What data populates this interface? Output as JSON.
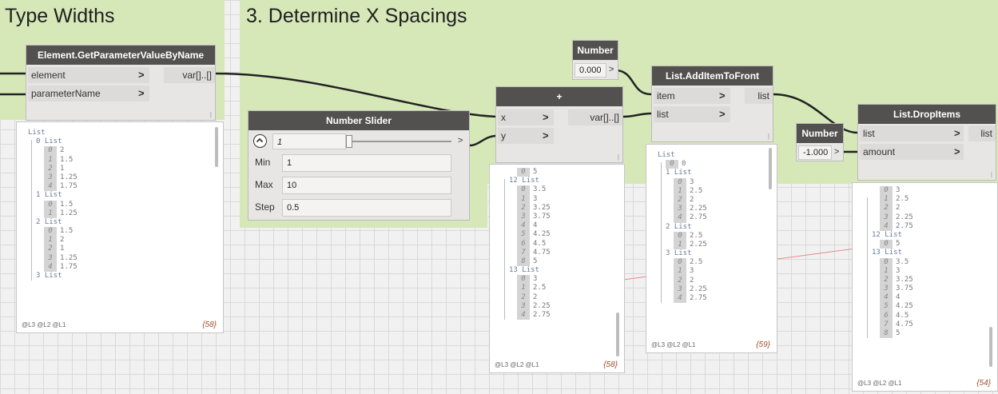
{
  "groups": {
    "type_widths": {
      "title": "Type Widths"
    },
    "x_spacings": {
      "title": "3. Determine X Spacings"
    }
  },
  "colors": {
    "group_bg": "#d6e8b8",
    "node_header": "#535150",
    "node_body": "#e7e6e5",
    "wire": "#222222"
  },
  "nodes": {
    "get_param": {
      "title": "Element.GetParameterValueByName",
      "inputs": [
        "element",
        "parameterName"
      ],
      "output": "var[]..[]"
    },
    "slider": {
      "title": "Number Slider",
      "value": "1",
      "min_label": "Min",
      "min": "1",
      "max_label": "Max",
      "max": "10",
      "step_label": "Step",
      "step": "0.5",
      "expander_icon": "chevron-up-icon"
    },
    "plus": {
      "title": "+",
      "inputs": [
        "x",
        "y"
      ],
      "output": "var[]..[]"
    },
    "number_top": {
      "title": "Number",
      "value": "0.000"
    },
    "add_front": {
      "title": "List.AddItemToFront",
      "inputs": [
        "item",
        "list"
      ],
      "output": "list"
    },
    "number_neg": {
      "title": "Number",
      "value": "-1.000"
    },
    "drop_items": {
      "title": "List.DropItems",
      "inputs": [
        "list",
        "amount"
      ],
      "output": "list"
    }
  },
  "arrow_glyph": ">",
  "grip_glyph": "|",
  "previews": {
    "p1": {
      "footer": "@L3 @L2 @L1",
      "count": "{58}",
      "rows": [
        {
          "t": "h",
          "text": "List",
          "ind": 0
        },
        {
          "t": "h",
          "text": "0 List",
          "ind": 1
        },
        {
          "t": "i",
          "i": "0",
          "v": "2",
          "ind": 2
        },
        {
          "t": "i",
          "i": "1",
          "v": "1.5",
          "ind": 2
        },
        {
          "t": "i",
          "i": "2",
          "v": "1",
          "ind": 2
        },
        {
          "t": "i",
          "i": "3",
          "v": "1.25",
          "ind": 2
        },
        {
          "t": "i",
          "i": "4",
          "v": "1.75",
          "ind": 2
        },
        {
          "t": "h",
          "text": "1 List",
          "ind": 1
        },
        {
          "t": "i",
          "i": "0",
          "v": "1.5",
          "ind": 2
        },
        {
          "t": "i",
          "i": "1",
          "v": "1.25",
          "ind": 2
        },
        {
          "t": "h",
          "text": "2 List",
          "ind": 1
        },
        {
          "t": "i",
          "i": "0",
          "v": "1.5",
          "ind": 2
        },
        {
          "t": "i",
          "i": "1",
          "v": "2",
          "ind": 2
        },
        {
          "t": "i",
          "i": "2",
          "v": "1",
          "ind": 2
        },
        {
          "t": "i",
          "i": "3",
          "v": "1.25",
          "ind": 2
        },
        {
          "t": "i",
          "i": "4",
          "v": "1.75",
          "ind": 2
        },
        {
          "t": "h",
          "text": "3 List",
          "ind": 1
        }
      ]
    },
    "p2": {
      "footer": "@L3 @L2 @L1",
      "count": "{58}",
      "rows": [
        {
          "t": "i",
          "i": "0",
          "v": "5",
          "ind": 2
        },
        {
          "t": "h",
          "text": "12 List",
          "ind": 1
        },
        {
          "t": "i",
          "i": "0",
          "v": "3.5",
          "ind": 2
        },
        {
          "t": "i",
          "i": "1",
          "v": "3",
          "ind": 2
        },
        {
          "t": "i",
          "i": "2",
          "v": "3.25",
          "ind": 2
        },
        {
          "t": "i",
          "i": "3",
          "v": "3.75",
          "ind": 2
        },
        {
          "t": "i",
          "i": "4",
          "v": "4",
          "ind": 2
        },
        {
          "t": "i",
          "i": "5",
          "v": "4.25",
          "ind": 2
        },
        {
          "t": "i",
          "i": "6",
          "v": "4.5",
          "ind": 2
        },
        {
          "t": "i",
          "i": "7",
          "v": "4.75",
          "ind": 2
        },
        {
          "t": "i",
          "i": "8",
          "v": "5",
          "ind": 2
        },
        {
          "t": "h",
          "text": "13 List",
          "ind": 1
        },
        {
          "t": "i",
          "i": "0",
          "v": "3",
          "ind": 2
        },
        {
          "t": "i",
          "i": "1",
          "v": "2.5",
          "ind": 2
        },
        {
          "t": "i",
          "i": "2",
          "v": "2",
          "ind": 2
        },
        {
          "t": "i",
          "i": "3",
          "v": "2.25",
          "ind": 2
        },
        {
          "t": "i",
          "i": "4",
          "v": "2.75",
          "ind": 2
        }
      ]
    },
    "p3": {
      "footer": "@L3 @L2 @L1",
      "count": "{59}",
      "rows": [
        {
          "t": "h",
          "text": "List",
          "ind": 0
        },
        {
          "t": "i",
          "i": "0",
          "v": "0",
          "ind": 1
        },
        {
          "t": "h",
          "text": "1 List",
          "ind": 1
        },
        {
          "t": "i",
          "i": "0",
          "v": "3",
          "ind": 2
        },
        {
          "t": "i",
          "i": "1",
          "v": "2.5",
          "ind": 2
        },
        {
          "t": "i",
          "i": "2",
          "v": "2",
          "ind": 2
        },
        {
          "t": "i",
          "i": "3",
          "v": "2.25",
          "ind": 2
        },
        {
          "t": "i",
          "i": "4",
          "v": "2.75",
          "ind": 2
        },
        {
          "t": "h",
          "text": "2 List",
          "ind": 1
        },
        {
          "t": "i",
          "i": "0",
          "v": "2.5",
          "ind": 2
        },
        {
          "t": "i",
          "i": "1",
          "v": "2.25",
          "ind": 2
        },
        {
          "t": "h",
          "text": "3 List",
          "ind": 1
        },
        {
          "t": "i",
          "i": "0",
          "v": "2.5",
          "ind": 2
        },
        {
          "t": "i",
          "i": "1",
          "v": "3",
          "ind": 2
        },
        {
          "t": "i",
          "i": "2",
          "v": "2",
          "ind": 2
        },
        {
          "t": "i",
          "i": "3",
          "v": "2.25",
          "ind": 2
        },
        {
          "t": "i",
          "i": "4",
          "v": "2.75",
          "ind": 2
        }
      ]
    },
    "p4": {
      "footer": "@L3 @L2 @L1",
      "count": "{54}",
      "rows": [
        {
          "t": "i",
          "i": "0",
          "v": "3",
          "ind": 2
        },
        {
          "t": "i",
          "i": "1",
          "v": "2.5",
          "ind": 2
        },
        {
          "t": "i",
          "i": "2",
          "v": "2",
          "ind": 2
        },
        {
          "t": "i",
          "i": "3",
          "v": "2.25",
          "ind": 2
        },
        {
          "t": "i",
          "i": "4",
          "v": "2.75",
          "ind": 2
        },
        {
          "t": "h",
          "text": "12 List",
          "ind": 1
        },
        {
          "t": "i",
          "i": "0",
          "v": "5",
          "ind": 2
        },
        {
          "t": "h",
          "text": "13 List",
          "ind": 1
        },
        {
          "t": "i",
          "i": "0",
          "v": "3.5",
          "ind": 2
        },
        {
          "t": "i",
          "i": "1",
          "v": "3",
          "ind": 2
        },
        {
          "t": "i",
          "i": "2",
          "v": "3.25",
          "ind": 2
        },
        {
          "t": "i",
          "i": "3",
          "v": "3.75",
          "ind": 2
        },
        {
          "t": "i",
          "i": "4",
          "v": "4",
          "ind": 2
        },
        {
          "t": "i",
          "i": "5",
          "v": "4.25",
          "ind": 2
        },
        {
          "t": "i",
          "i": "6",
          "v": "4.5",
          "ind": 2
        },
        {
          "t": "i",
          "i": "7",
          "v": "4.75",
          "ind": 2
        },
        {
          "t": "i",
          "i": "8",
          "v": "5",
          "ind": 2
        }
      ]
    }
  }
}
